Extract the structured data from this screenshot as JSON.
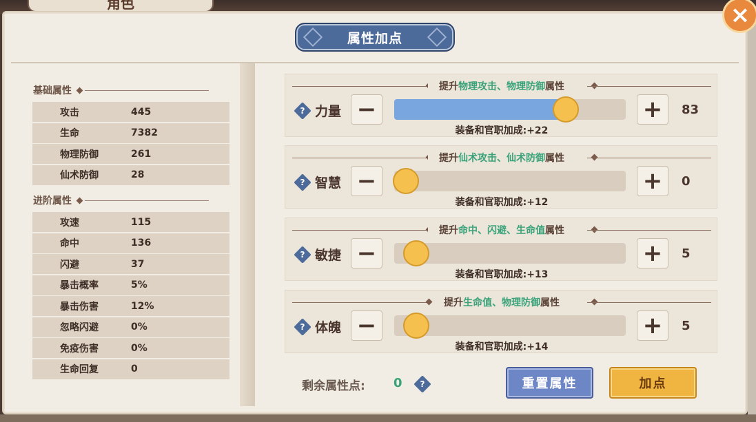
{
  "background_tab_text": "角色",
  "title": "属性加点",
  "close_icon": "×",
  "basic_section": {
    "title": "基础属性",
    "rows": [
      {
        "name": "攻击",
        "value": "445"
      },
      {
        "name": "生命",
        "value": "7382"
      },
      {
        "name": "物理防御",
        "value": "261"
      },
      {
        "name": "仙术防御",
        "value": "28"
      }
    ]
  },
  "advanced_section": {
    "title": "进阶属性",
    "rows": [
      {
        "name": "攻速",
        "value": "115"
      },
      {
        "name": "命中",
        "value": "136"
      },
      {
        "name": "闪避",
        "value": "37"
      },
      {
        "name": "暴击概率",
        "value": "5%"
      },
      {
        "name": "暴击伤害",
        "value": "12%"
      },
      {
        "name": "忽略闪避",
        "value": "0%"
      },
      {
        "name": "免疫伤害",
        "value": "0%"
      },
      {
        "name": "生命回复",
        "value": "0"
      }
    ]
  },
  "attributes": [
    {
      "name": "力量",
      "pre": "提升",
      "highlight": "物理攻击、物理防御",
      "post": "属性",
      "value": "83",
      "bonus": "装备和官职加成:+22",
      "slider_level": 0.78
    },
    {
      "name": "智慧",
      "pre": "提升",
      "highlight": "仙术攻击、仙术防御",
      "post": "属性",
      "value": "0",
      "bonus": "装备和官职加成:+12",
      "slider_level": 0.0
    },
    {
      "name": "敏捷",
      "pre": "提升",
      "highlight": "命中、闪避、生命值",
      "post": "属性",
      "value": "5",
      "bonus": "装备和官职加成:+13",
      "slider_level": 0.05
    },
    {
      "name": "体魄",
      "pre": "提升",
      "highlight": "生命值、物理防御",
      "post": "属性",
      "value": "5",
      "bonus": "装备和官职加成:+14",
      "slider_level": 0.05
    }
  ],
  "minus_symbol": "−",
  "plus_symbol": "+",
  "help_symbol": "?",
  "remaining_label": "剩余属性点:",
  "remaining_value": "0",
  "reset_button": "重置属性",
  "add_button": "加点",
  "colors": {
    "highlight_green": "#3aa27a",
    "slider_fill": "#7aa6e0",
    "knob": "#f5c04e",
    "reset_blue": "#6d86c6",
    "add_gold": "#f0b440"
  }
}
